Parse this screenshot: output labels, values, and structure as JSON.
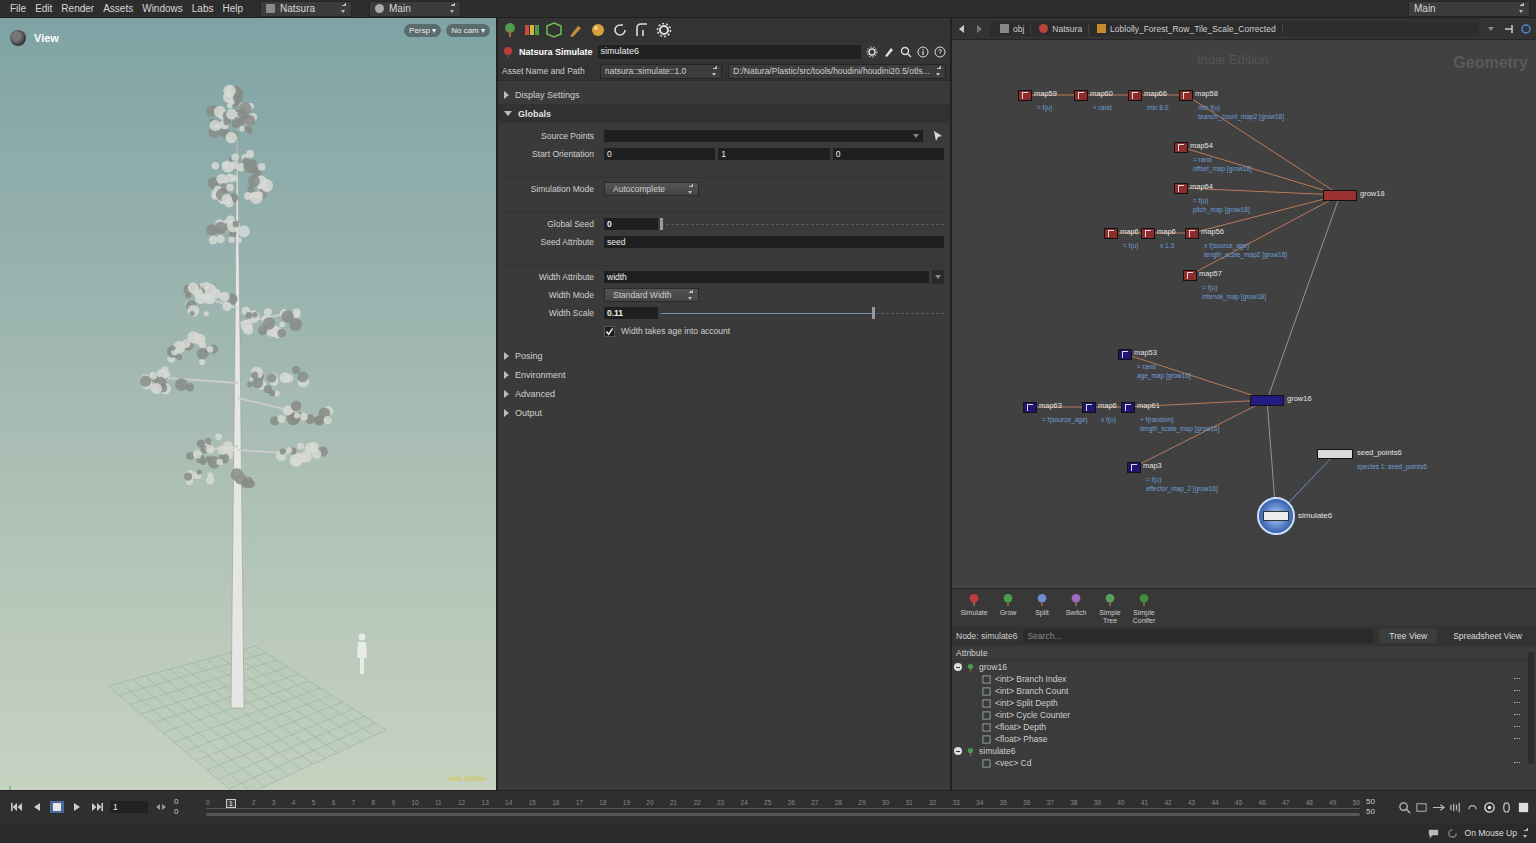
{
  "menu": [
    "File",
    "Edit",
    "Render",
    "Assets",
    "Windows",
    "Labs",
    "Help"
  ],
  "desktop": "Natsura",
  "pane_tab": "Main",
  "right_desktop": "Main",
  "viewport": {
    "title": "View",
    "camera_buttons": [
      "Persp ▾",
      "No cam ▾"
    ],
    "watermark": "Indie Edition"
  },
  "params": {
    "node_type": "Natsura Simulate",
    "node_name": "simulate6",
    "asset_label": "Asset Name and Path",
    "asset_name": "natsura::simulate::1.0",
    "asset_path": "D:/Natura/Plastic/src/tools/houdini/houdini20.5/otls...",
    "sections": [
      {
        "label": "Display Settings",
        "expanded": false
      },
      {
        "label": "Globals",
        "expanded": true
      },
      {
        "label": "Posing",
        "expanded": false
      },
      {
        "label": "Environment",
        "expanded": false
      },
      {
        "label": "Advanced",
        "expanded": false
      },
      {
        "label": "Output",
        "expanded": false
      }
    ],
    "globals": [
      {
        "kind": "pick",
        "label": "Source Points",
        "value": ""
      },
      {
        "kind": "vector",
        "label": "Start Orientation",
        "values": [
          "0",
          "1",
          "0"
        ]
      },
      {
        "kind": "separator"
      },
      {
        "kind": "menu",
        "label": "Simulation Mode",
        "value": "Autocomplete"
      },
      {
        "kind": "separator"
      },
      {
        "kind": "slider",
        "label": "Global Seed",
        "value": "0",
        "level": 0.0
      },
      {
        "kind": "text",
        "label": "Seed Attribute",
        "value": "seed"
      },
      {
        "kind": "separator"
      },
      {
        "kind": "combo",
        "label": "Width Attribute",
        "value": "width"
      },
      {
        "kind": "menu",
        "label": "Width Mode",
        "value": "Standard Width"
      },
      {
        "kind": "slider",
        "label": "Width Scale",
        "value": "0.11",
        "level": 0.75
      },
      {
        "kind": "checkbox",
        "label": "Width takes age into account",
        "checked": true
      }
    ]
  },
  "network": {
    "path": [
      "obj",
      "Natsura",
      "Loblolly_Forest_Row_Tile_Scale_Corrected"
    ],
    "edition": "Indie Edition",
    "context": "Geometry",
    "nodes": [
      {
        "label": "map59",
        "kind": "map",
        "color": "#8e2b2b",
        "notes": [
          "= f(u)"
        ]
      },
      {
        "label": "map60",
        "kind": "map",
        "color": "#8e2b2b",
        "notes": [
          "+ rand"
        ]
      },
      {
        "label": "map66",
        "kind": "map",
        "color": "#8e2b2b",
        "notes": [
          "min 8.0"
        ]
      },
      {
        "label": "map58",
        "kind": "map",
        "color": "#8e2b2b",
        "notes": [
          "min f(u)",
          "branch_count_map2 [grow18]"
        ]
      },
      {
        "label": "map54",
        "kind": "map",
        "color": "#8e2b2b",
        "notes": [
          "= rand",
          "offset_map [grow18]"
        ]
      },
      {
        "label": "map64",
        "kind": "map",
        "color": "#8e2b2b",
        "notes": [
          "= f(u)",
          "pitch_map [grow18]"
        ]
      },
      {
        "label": "map6",
        "kind": "map",
        "color": "#8e2b2b",
        "notes": [
          "= f(u)"
        ]
      },
      {
        "label": "map6",
        "kind": "map",
        "color": "#8e2b2b",
        "notes": [
          "x 1.3"
        ]
      },
      {
        "label": "map56",
        "kind": "map",
        "color": "#8e2b2b",
        "notes": [
          "x f(source_age)",
          "length_scale_map2 [grow18]"
        ]
      },
      {
        "label": "map57",
        "kind": "map",
        "color": "#8e2b2b",
        "notes": [
          "= f(u)",
          "interval_map [grow18]"
        ]
      },
      {
        "label": "grow18",
        "kind": "grow",
        "color": "#9a3232",
        "notes": []
      },
      {
        "label": "map53",
        "kind": "map",
        "color": "#1e1670",
        "notes": [
          "= rand",
          "age_map [grow16]"
        ]
      },
      {
        "label": "map63",
        "kind": "map",
        "color": "#1e1670",
        "notes": [
          "= f(source_age)"
        ]
      },
      {
        "label": "map6",
        "kind": "map",
        "color": "#1e1670",
        "notes": [
          "x f(u)"
        ]
      },
      {
        "label": "map61",
        "kind": "map",
        "color": "#1e1670",
        "notes": [
          "+ f(random)",
          "length_scale_map [grow16]"
        ]
      },
      {
        "label": "map3",
        "kind": "map",
        "color": "#1e1670",
        "notes": [
          "= f(u)",
          "effector_map_2 [grow16]"
        ]
      },
      {
        "label": "grow16",
        "kind": "grow",
        "color": "#231a82",
        "notes": []
      },
      {
        "label": "seed_points6",
        "kind": "seed",
        "color": "#d9d9d9",
        "notes": [
          "species 1: seed_points6"
        ]
      },
      {
        "label": "simulate6",
        "kind": "simulate",
        "color": "#3b6fc4",
        "notes": []
      }
    ],
    "edges": [
      [
        0,
        1
      ],
      [
        1,
        2
      ],
      [
        2,
        3
      ],
      [
        3,
        10
      ],
      [
        4,
        10
      ],
      [
        5,
        10
      ],
      [
        6,
        7
      ],
      [
        7,
        8
      ],
      [
        8,
        10
      ],
      [
        9,
        10
      ],
      [
        10,
        16
      ],
      [
        11,
        16
      ],
      [
        12,
        13
      ],
      [
        13,
        14
      ],
      [
        14,
        16
      ],
      [
        15,
        16
      ],
      [
        16,
        18
      ],
      [
        17,
        18
      ]
    ],
    "shelf": [
      "Simulate",
      "Grow",
      "Split",
      "Switch",
      "Simple Tree",
      "Simple Conifer"
    ],
    "node_bar": {
      "label": "Node: simulate6",
      "search_placeholder": "Search...",
      "buttons": [
        {
          "label": "Tree View",
          "selected": true
        },
        {
          "label": "Spreadsheet View",
          "selected": false
        }
      ]
    },
    "tree": {
      "header": "Attribute",
      "groups": [
        {
          "name": "grow16",
          "expanded": true,
          "items": [
            "<int> Branch Index",
            "<int> Branch Count",
            "<int> Split Depth",
            "<int> Cycle Counter",
            "<float> Depth",
            "<float> Phase"
          ]
        },
        {
          "name": "simulate6",
          "expanded": true,
          "items": [
            "<vec> Cd"
          ]
        }
      ]
    }
  },
  "timeline": {
    "frame": "1",
    "start": [
      "0",
      "0"
    ],
    "end": [
      "50",
      "50"
    ],
    "current": "1",
    "ticks": [
      "0",
      "1",
      "2",
      "3",
      "4",
      "5",
      "6",
      "7",
      "8",
      "9",
      "10",
      "11",
      "12",
      "13",
      "14",
      "15",
      "16",
      "17",
      "18",
      "19",
      "20",
      "21",
      "22",
      "23",
      "24",
      "25",
      "26",
      "27",
      "28",
      "29",
      "30",
      "31",
      "32",
      "33",
      "34",
      "35",
      "36",
      "37",
      "38",
      "39",
      "40",
      "41",
      "42",
      "43",
      "44",
      "45",
      "46",
      "47",
      "48",
      "49",
      "50"
    ]
  },
  "status": {
    "update_mode": "On Mouse Up"
  }
}
